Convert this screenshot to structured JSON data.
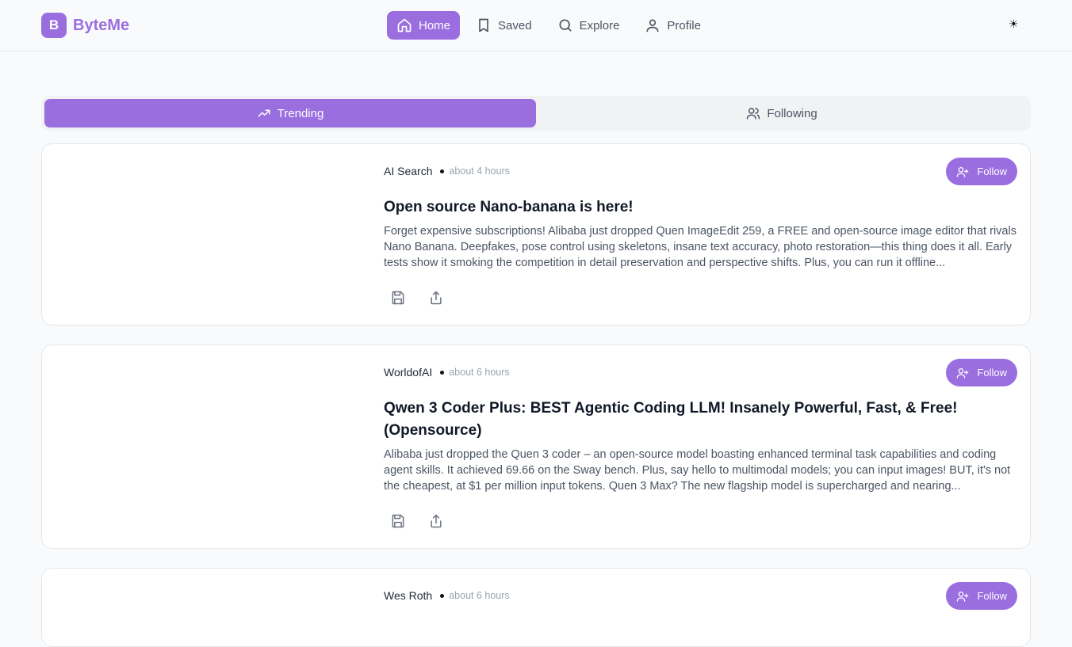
{
  "brand": {
    "logo_letter": "B",
    "name": "ByteMe",
    "color": "#9b6ee0"
  },
  "nav": {
    "items": [
      {
        "label": "Home",
        "icon": "home-icon",
        "active": true
      },
      {
        "label": "Saved",
        "icon": "bookmark-icon",
        "active": false
      },
      {
        "label": "Explore",
        "icon": "search-icon",
        "active": false
      },
      {
        "label": "Profile",
        "icon": "user-icon",
        "active": false
      }
    ],
    "theme_toggle": "☀"
  },
  "tabs": [
    {
      "label": "Trending",
      "icon": "trending-up-icon",
      "active": true
    },
    {
      "label": "Following",
      "icon": "users-icon",
      "active": false
    }
  ],
  "posts": [
    {
      "author": "AI Search",
      "time": "about 4 hours",
      "follow_label": "Follow",
      "title": "Open source Nano-banana is here!",
      "summary": "Forget expensive subscriptions! Alibaba just dropped Quen ImageEdit 259, a FREE and open-source image editor that rivals Nano Banana. Deepfakes, pose control using skeletons, insane text accuracy, photo restoration—this thing does it all. Early tests show it smoking the competition in detail preservation and perspective shifts. Plus, you can run it offline..."
    },
    {
      "author": "WorldofAI",
      "time": "about 6 hours",
      "follow_label": "Follow",
      "title": "Qwen 3 Coder Plus: BEST Agentic Coding LLM! Insanely Powerful, Fast, & Free! (Opensource)",
      "summary": "Alibaba just dropped the Quen 3 coder – an open-source model boasting enhanced terminal task capabilities and coding agent skills. It achieved 69.66 on the Sway bench. Plus, say hello to multimodal models; you can input images! BUT, it's not the cheapest, at $1 per million input tokens. Quen 3 Max? The new flagship model is supercharged and nearing..."
    },
    {
      "author": "Wes Roth",
      "time": "about 6 hours",
      "follow_label": "Follow",
      "title": "",
      "summary": ""
    }
  ]
}
